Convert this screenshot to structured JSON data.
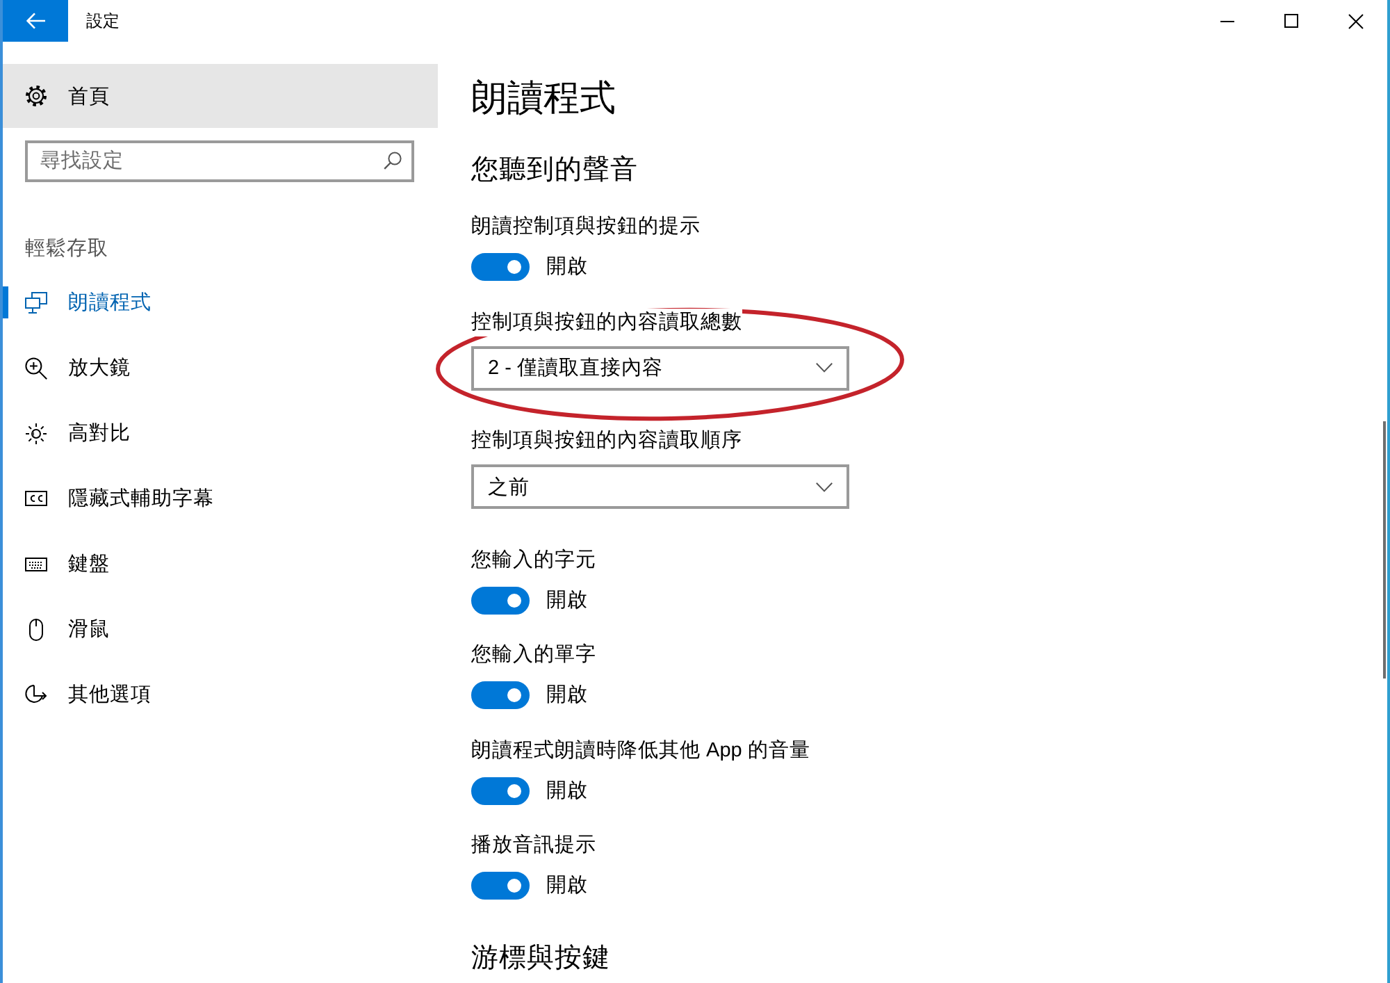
{
  "window": {
    "title": "設定"
  },
  "sidebar": {
    "home": {
      "label": "首頁"
    },
    "search": {
      "placeholder": "尋找設定"
    },
    "category": "輕鬆存取",
    "items": [
      {
        "label": "朗讀程式",
        "selected": true
      },
      {
        "label": "放大鏡",
        "selected": false
      },
      {
        "label": "高對比",
        "selected": false
      },
      {
        "label": "隱藏式輔助字幕",
        "selected": false
      },
      {
        "label": "鍵盤",
        "selected": false
      },
      {
        "label": "滑鼠",
        "selected": false
      },
      {
        "label": "其他選項",
        "selected": false
      }
    ]
  },
  "page": {
    "title": "朗讀程式",
    "sections": [
      {
        "heading": "您聽到的聲音",
        "settings": [
          {
            "kind": "toggle",
            "label": "朗讀控制項與按鈕的提示",
            "on": true,
            "state_text": "開啟"
          },
          {
            "kind": "dropdown",
            "label": "控制項與按鈕的內容讀取總數",
            "value": "2 - 僅讀取直接內容"
          },
          {
            "kind": "dropdown",
            "label": "控制項與按鈕的內容讀取順序",
            "value": "之前"
          },
          {
            "kind": "toggle",
            "label": "您輸入的字元",
            "on": true,
            "state_text": "開啟"
          },
          {
            "kind": "toggle",
            "label": "您輸入的單字",
            "on": true,
            "state_text": "開啟"
          },
          {
            "kind": "toggle",
            "label": "朗讀程式朗讀時降低其他 App 的音量",
            "on": true,
            "state_text": "開啟"
          },
          {
            "kind": "toggle",
            "label": "播放音訊提示",
            "on": true,
            "state_text": "開啟"
          }
        ]
      },
      {
        "heading": "游標與按鍵"
      }
    ]
  }
}
